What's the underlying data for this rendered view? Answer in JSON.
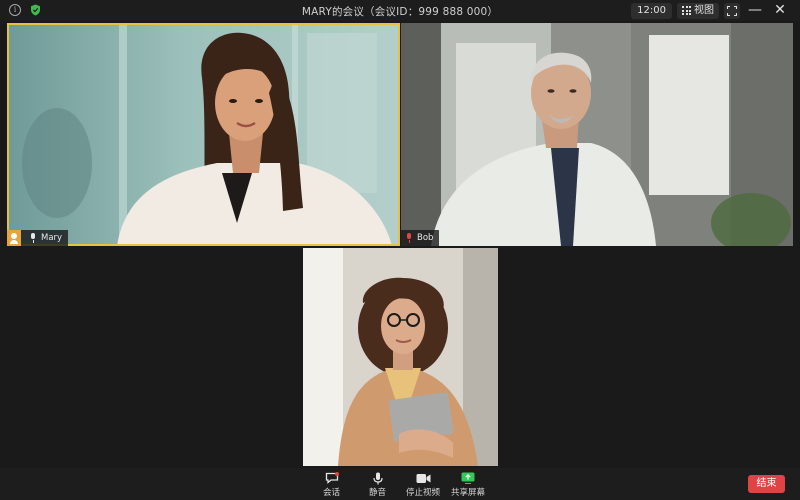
{
  "window": {
    "title": "MARY的会议（会议ID：999 888 000）",
    "clock": "12:00",
    "view_label": "视图",
    "minimize_symbol": "—",
    "close_symbol": "✕"
  },
  "icons": {
    "info": "info-icon",
    "security": "shield-icon",
    "view": "grid-icon",
    "fullscreen": "fullscreen-icon",
    "chat": "chat-icon",
    "mic": "microphone-icon",
    "video": "video-camera-icon",
    "share": "share-screen-icon"
  },
  "participants": [
    {
      "name": "Mary",
      "host": true,
      "mic": "on",
      "active_speaker": true
    },
    {
      "name": "Bob",
      "host": false,
      "mic": "muted",
      "active_speaker": false
    },
    {
      "name": "",
      "host": false,
      "mic": "",
      "active_speaker": false
    }
  ],
  "toolbar": {
    "chat_label": "会话",
    "mute_label": "静音",
    "stop_video_label": "停止视频",
    "share_label": "共享屏幕",
    "end_label": "结束"
  },
  "colors": {
    "active_speaker_border": "#e8c23c",
    "end_button": "#e04343",
    "security_shield": "#3fb950",
    "share_icon": "#34c759",
    "muted_mic": "#e04646",
    "host_badge": "#e8a43c"
  }
}
